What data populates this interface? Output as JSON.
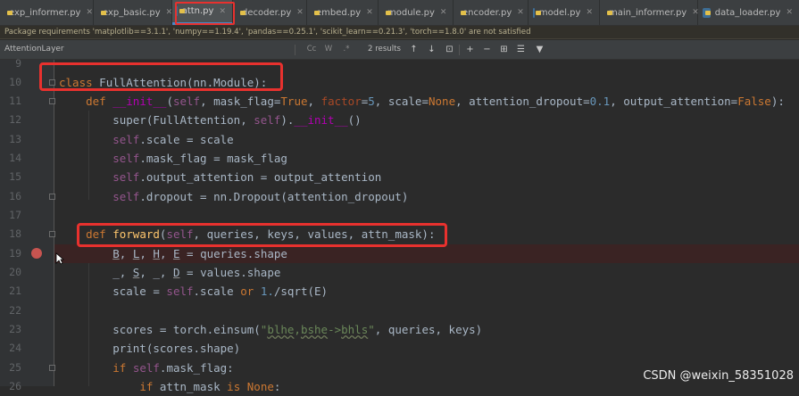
{
  "tabs": [
    {
      "label": "exp_informer.py",
      "active": false
    },
    {
      "label": "exp_basic.py",
      "active": false
    },
    {
      "label": "attn.py",
      "active": true
    },
    {
      "label": "decoder.py",
      "active": false
    },
    {
      "label": "embed.py",
      "active": false
    },
    {
      "label": "module.py",
      "active": false
    },
    {
      "label": "encoder.py",
      "active": false
    },
    {
      "label": "model.py",
      "active": false
    },
    {
      "label": "main_informer.py",
      "active": false
    },
    {
      "label": "data_loader.py",
      "active": false
    }
  ],
  "warning": "Package requirements 'matplotlib==3.1.1', 'numpy==1.19.4', 'pandas==0.25.1', 'scikit_learn==0.21.3', 'torch==1.8.0' are not satisfied",
  "search": {
    "query": "AttentionLayer",
    "options": [
      "Cc",
      "W",
      ".*"
    ],
    "results": "2 results"
  },
  "line_numbers": [
    "9",
    "10",
    "11",
    "12",
    "13",
    "14",
    "15",
    "16",
    "17",
    "18",
    "19",
    "20",
    "21",
    "22",
    "23",
    "24",
    "25",
    "26"
  ],
  "watermark": "CSDN @weixin_58351028",
  "colors": {
    "keyword": "#cc7832",
    "function": "#ffc66d",
    "number": "#6897bb",
    "self": "#94558d",
    "string": "#6a8759",
    "highlight_box": "#e8312e",
    "breakpoint": "#c75450"
  }
}
